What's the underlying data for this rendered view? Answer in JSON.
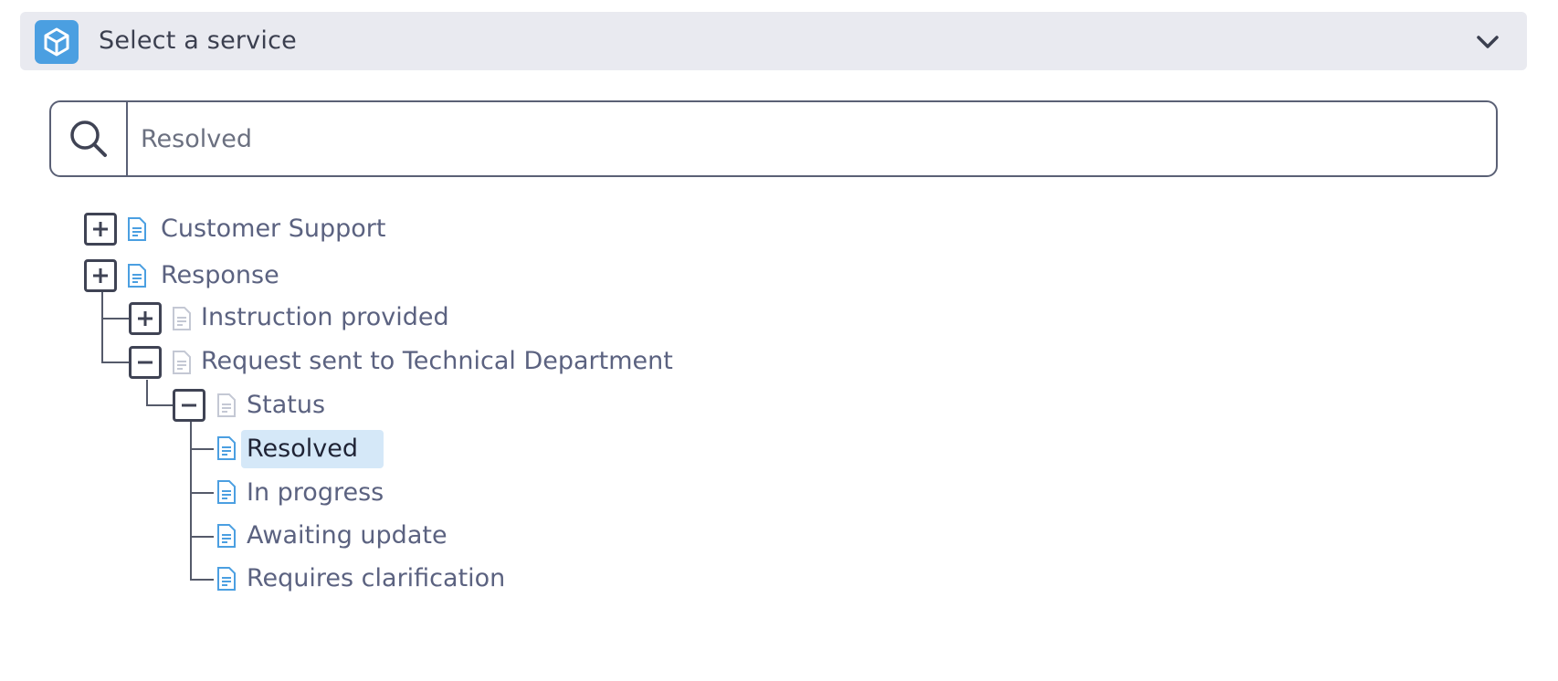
{
  "header": {
    "title": "Select a service",
    "logo_icon": "cube-icon",
    "toggle_icon": "chevron-down-icon",
    "brand_color": "#4b9fe1"
  },
  "search": {
    "icon": "search-icon",
    "value": "Resolved"
  },
  "tree": {
    "nodes": [
      {
        "label": "Customer Support",
        "toggle": "plus"
      },
      {
        "label": "Response",
        "toggle": "plus"
      },
      {
        "label": "Instruction provided",
        "toggle": "plus"
      },
      {
        "label": "Request sent to Technical Department",
        "toggle": "minus"
      },
      {
        "label": "Status",
        "toggle": "minus"
      },
      {
        "label": "Resolved",
        "selected": true
      },
      {
        "label": "In progress"
      },
      {
        "label": "Awaiting update"
      },
      {
        "label": "Requires clarification"
      }
    ],
    "selection_color": "#d5e8f8"
  }
}
